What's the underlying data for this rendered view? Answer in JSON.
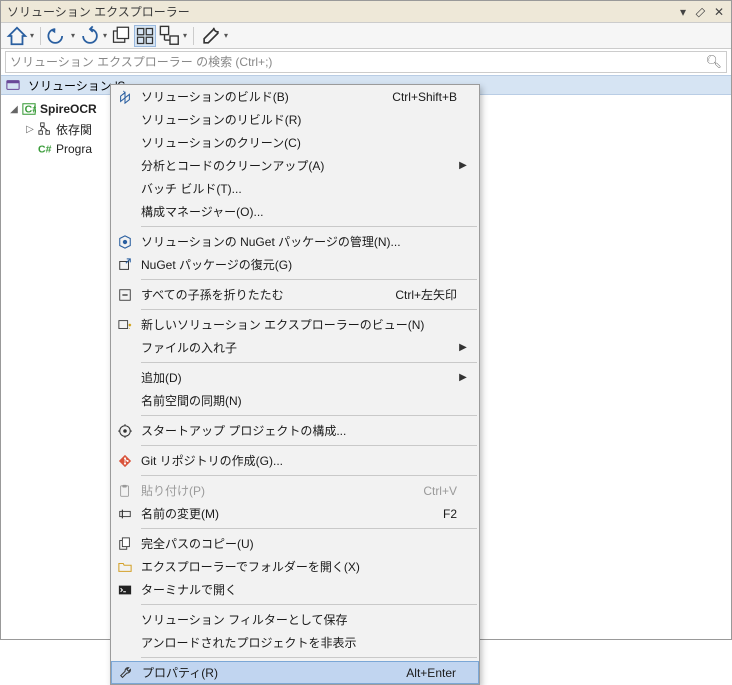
{
  "titlebar": {
    "title": "ソリューション エクスプローラー"
  },
  "search": {
    "placeholder": "ソリューション エクスプローラー の検索 (Ctrl+;)"
  },
  "sln_bar": {
    "text": "ソリューション 'S"
  },
  "tree": {
    "project": "SpireOCR",
    "deps": "依存関",
    "file": "Progra"
  },
  "menu": {
    "items": [
      {
        "label": "ソリューションのビルド(B)",
        "shortcut": "Ctrl+Shift+B",
        "icon": "build"
      },
      {
        "label": "ソリューションのリビルド(R)"
      },
      {
        "label": "ソリューションのクリーン(C)"
      },
      {
        "label": "分析とコードのクリーンアップ(A)",
        "submenu": true
      },
      {
        "label": "バッチ ビルド(T)..."
      },
      {
        "label": "構成マネージャー(O)..."
      },
      {
        "sep": true
      },
      {
        "label": "ソリューションの NuGet パッケージの管理(N)...",
        "icon": "nuget"
      },
      {
        "label": "NuGet パッケージの復元(G)",
        "icon": "restore"
      },
      {
        "sep": true
      },
      {
        "label": "すべての子孫を折りたたむ",
        "shortcut": "Ctrl+左矢印",
        "icon": "collapse"
      },
      {
        "sep": true
      },
      {
        "label": "新しいソリューション エクスプローラーのビュー(N)",
        "icon": "newview"
      },
      {
        "label": "ファイルの入れ子",
        "submenu": true
      },
      {
        "sep": true
      },
      {
        "label": "追加(D)",
        "submenu": true
      },
      {
        "label": "名前空間の同期(N)"
      },
      {
        "sep": true
      },
      {
        "label": "スタートアップ プロジェクトの構成...",
        "icon": "startup"
      },
      {
        "sep": true
      },
      {
        "label": "Git リポジトリの作成(G)...",
        "icon": "git"
      },
      {
        "sep": true
      },
      {
        "label": "貼り付け(P)",
        "shortcut": "Ctrl+V",
        "icon": "paste",
        "disabled": true
      },
      {
        "label": "名前の変更(M)",
        "shortcut": "F2",
        "icon": "rename"
      },
      {
        "sep": true
      },
      {
        "label": "完全パスのコピー(U)",
        "icon": "copy"
      },
      {
        "label": "エクスプローラーでフォルダーを開く(X)",
        "icon": "folder"
      },
      {
        "label": "ターミナルで開く",
        "icon": "terminal"
      },
      {
        "sep": true
      },
      {
        "label": "ソリューション フィルターとして保存"
      },
      {
        "label": "アンロードされたプロジェクトを非表示"
      },
      {
        "sep": true
      },
      {
        "label": "プロパティ(R)",
        "shortcut": "Alt+Enter",
        "icon": "wrench",
        "highlight": true
      }
    ]
  }
}
